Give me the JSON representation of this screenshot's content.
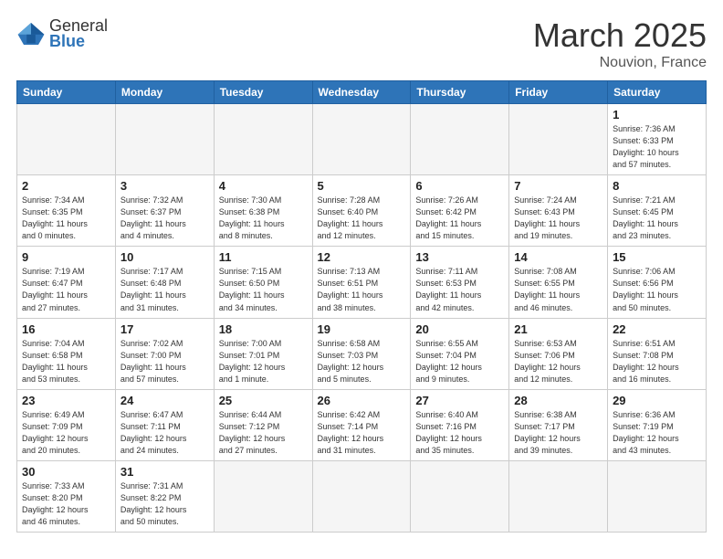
{
  "header": {
    "logo_general": "General",
    "logo_blue": "Blue",
    "title": "March 2025",
    "subtitle": "Nouvion, France"
  },
  "weekdays": [
    "Sunday",
    "Monday",
    "Tuesday",
    "Wednesday",
    "Thursday",
    "Friday",
    "Saturday"
  ],
  "weeks": [
    [
      {
        "day": "",
        "info": ""
      },
      {
        "day": "",
        "info": ""
      },
      {
        "day": "",
        "info": ""
      },
      {
        "day": "",
        "info": ""
      },
      {
        "day": "",
        "info": ""
      },
      {
        "day": "",
        "info": ""
      },
      {
        "day": "1",
        "info": "Sunrise: 7:36 AM\nSunset: 6:33 PM\nDaylight: 10 hours\nand 57 minutes."
      }
    ],
    [
      {
        "day": "2",
        "info": "Sunrise: 7:34 AM\nSunset: 6:35 PM\nDaylight: 11 hours\nand 0 minutes."
      },
      {
        "day": "3",
        "info": "Sunrise: 7:32 AM\nSunset: 6:37 PM\nDaylight: 11 hours\nand 4 minutes."
      },
      {
        "day": "4",
        "info": "Sunrise: 7:30 AM\nSunset: 6:38 PM\nDaylight: 11 hours\nand 8 minutes."
      },
      {
        "day": "5",
        "info": "Sunrise: 7:28 AM\nSunset: 6:40 PM\nDaylight: 11 hours\nand 12 minutes."
      },
      {
        "day": "6",
        "info": "Sunrise: 7:26 AM\nSunset: 6:42 PM\nDaylight: 11 hours\nand 15 minutes."
      },
      {
        "day": "7",
        "info": "Sunrise: 7:24 AM\nSunset: 6:43 PM\nDaylight: 11 hours\nand 19 minutes."
      },
      {
        "day": "8",
        "info": "Sunrise: 7:21 AM\nSunset: 6:45 PM\nDaylight: 11 hours\nand 23 minutes."
      }
    ],
    [
      {
        "day": "9",
        "info": "Sunrise: 7:19 AM\nSunset: 6:47 PM\nDaylight: 11 hours\nand 27 minutes."
      },
      {
        "day": "10",
        "info": "Sunrise: 7:17 AM\nSunset: 6:48 PM\nDaylight: 11 hours\nand 31 minutes."
      },
      {
        "day": "11",
        "info": "Sunrise: 7:15 AM\nSunset: 6:50 PM\nDaylight: 11 hours\nand 34 minutes."
      },
      {
        "day": "12",
        "info": "Sunrise: 7:13 AM\nSunset: 6:51 PM\nDaylight: 11 hours\nand 38 minutes."
      },
      {
        "day": "13",
        "info": "Sunrise: 7:11 AM\nSunset: 6:53 PM\nDaylight: 11 hours\nand 42 minutes."
      },
      {
        "day": "14",
        "info": "Sunrise: 7:08 AM\nSunset: 6:55 PM\nDaylight: 11 hours\nand 46 minutes."
      },
      {
        "day": "15",
        "info": "Sunrise: 7:06 AM\nSunset: 6:56 PM\nDaylight: 11 hours\nand 50 minutes."
      }
    ],
    [
      {
        "day": "16",
        "info": "Sunrise: 7:04 AM\nSunset: 6:58 PM\nDaylight: 11 hours\nand 53 minutes."
      },
      {
        "day": "17",
        "info": "Sunrise: 7:02 AM\nSunset: 7:00 PM\nDaylight: 11 hours\nand 57 minutes."
      },
      {
        "day": "18",
        "info": "Sunrise: 7:00 AM\nSunset: 7:01 PM\nDaylight: 12 hours\nand 1 minute."
      },
      {
        "day": "19",
        "info": "Sunrise: 6:58 AM\nSunset: 7:03 PM\nDaylight: 12 hours\nand 5 minutes."
      },
      {
        "day": "20",
        "info": "Sunrise: 6:55 AM\nSunset: 7:04 PM\nDaylight: 12 hours\nand 9 minutes."
      },
      {
        "day": "21",
        "info": "Sunrise: 6:53 AM\nSunset: 7:06 PM\nDaylight: 12 hours\nand 12 minutes."
      },
      {
        "day": "22",
        "info": "Sunrise: 6:51 AM\nSunset: 7:08 PM\nDaylight: 12 hours\nand 16 minutes."
      }
    ],
    [
      {
        "day": "23",
        "info": "Sunrise: 6:49 AM\nSunset: 7:09 PM\nDaylight: 12 hours\nand 20 minutes."
      },
      {
        "day": "24",
        "info": "Sunrise: 6:47 AM\nSunset: 7:11 PM\nDaylight: 12 hours\nand 24 minutes."
      },
      {
        "day": "25",
        "info": "Sunrise: 6:44 AM\nSunset: 7:12 PM\nDaylight: 12 hours\nand 27 minutes."
      },
      {
        "day": "26",
        "info": "Sunrise: 6:42 AM\nSunset: 7:14 PM\nDaylight: 12 hours\nand 31 minutes."
      },
      {
        "day": "27",
        "info": "Sunrise: 6:40 AM\nSunset: 7:16 PM\nDaylight: 12 hours\nand 35 minutes."
      },
      {
        "day": "28",
        "info": "Sunrise: 6:38 AM\nSunset: 7:17 PM\nDaylight: 12 hours\nand 39 minutes."
      },
      {
        "day": "29",
        "info": "Sunrise: 6:36 AM\nSunset: 7:19 PM\nDaylight: 12 hours\nand 43 minutes."
      }
    ],
    [
      {
        "day": "30",
        "info": "Sunrise: 7:33 AM\nSunset: 8:20 PM\nDaylight: 12 hours\nand 46 minutes."
      },
      {
        "day": "31",
        "info": "Sunrise: 7:31 AM\nSunset: 8:22 PM\nDaylight: 12 hours\nand 50 minutes."
      },
      {
        "day": "",
        "info": ""
      },
      {
        "day": "",
        "info": ""
      },
      {
        "day": "",
        "info": ""
      },
      {
        "day": "",
        "info": ""
      },
      {
        "day": "",
        "info": ""
      }
    ]
  ]
}
